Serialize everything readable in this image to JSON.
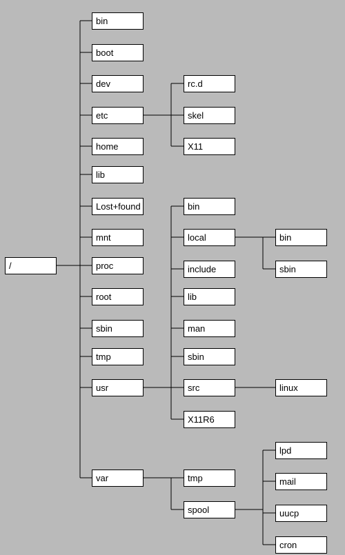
{
  "tree": {
    "root": "/",
    "level1": [
      "bin",
      "boot",
      "dev",
      "etc",
      "home",
      "lib",
      "Lost+found",
      "mnt",
      "proc",
      "root",
      "sbin",
      "tmp",
      "usr",
      "var"
    ],
    "etc_children": [
      "rc.d",
      "skel",
      "X11"
    ],
    "usr_children": [
      "bin",
      "local",
      "include",
      "lib",
      "man",
      "sbin",
      "src",
      "X11R6"
    ],
    "usr_local_children": [
      "bin",
      "sbin"
    ],
    "usr_src_children": [
      "linux"
    ],
    "var_children": [
      "tmp",
      "spool"
    ],
    "var_spool_children": [
      "lpd",
      "mail",
      "uucp",
      "cron"
    ]
  }
}
